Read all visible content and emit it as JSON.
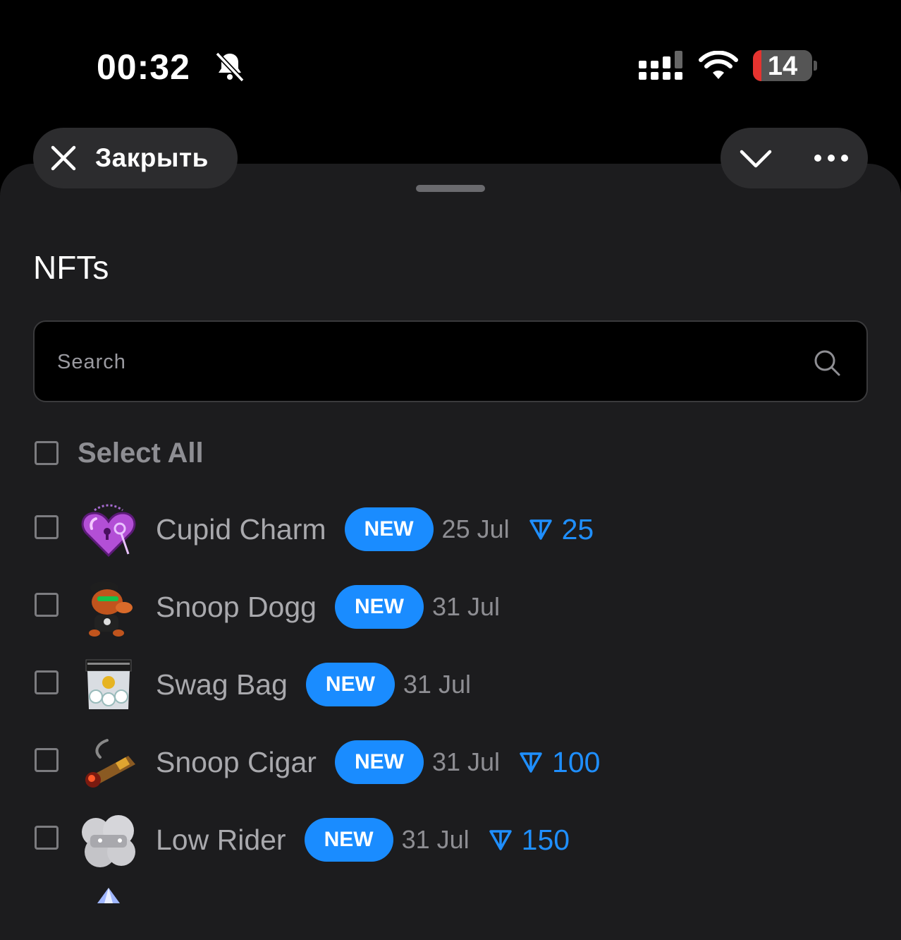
{
  "status_bar": {
    "time": "00:32",
    "battery": "14",
    "battery_level_percent": 14,
    "icons": [
      "bell-slash-icon",
      "cellular-signal-icon",
      "wifi-icon",
      "battery-icon"
    ]
  },
  "header": {
    "close_label": "Закрыть",
    "icons": [
      "close-icon",
      "chevron-down-icon",
      "more-icon"
    ]
  },
  "page": {
    "title": "NFTs"
  },
  "search": {
    "placeholder": "Search",
    "value": ""
  },
  "select_all": {
    "label": "Select All",
    "checked": false
  },
  "badge_label": "NEW",
  "items": [
    {
      "name": "Cupid Charm",
      "badge": "NEW",
      "date": "25 Jul",
      "price": "25",
      "checked": false,
      "thumb_color": "#b34fd6"
    },
    {
      "name": "Snoop Dogg",
      "badge": "NEW",
      "date": "31 Jul",
      "price": "",
      "checked": false,
      "thumb_color": "#c0541d"
    },
    {
      "name": "Swag Bag",
      "badge": "NEW",
      "date": "31 Jul",
      "price": "",
      "checked": false,
      "thumb_color": "#d9dde2"
    },
    {
      "name": "Snoop Cigar",
      "badge": "NEW",
      "date": "31 Jul",
      "price": "100",
      "checked": false,
      "thumb_color": "#c9892b"
    },
    {
      "name": "Low Rider",
      "badge": "NEW",
      "date": "31 Jul",
      "price": "150",
      "checked": false,
      "thumb_color": "#d6d6da"
    }
  ],
  "colors": {
    "background": "#1c1c1e",
    "accent": "#1a8cff",
    "price": "#1f8fff",
    "muted_text": "#8e8e93"
  }
}
